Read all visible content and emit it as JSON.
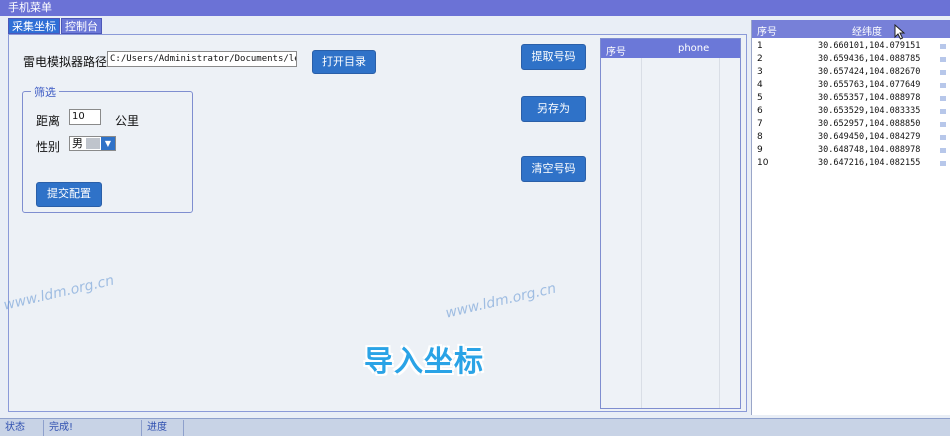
{
  "menubar": {
    "title": "手机菜单"
  },
  "tabs": [
    {
      "label": "采集坐标",
      "active": true
    },
    {
      "label": "控制台",
      "active": false
    }
  ],
  "form": {
    "path_label": "雷电模拟器路径",
    "path_value": "C:/Users/Administrator/Documents/leidi",
    "open_dir_label": "打开目录",
    "filter_group_label": "筛选",
    "distance_label": "距离",
    "distance_value": "10",
    "distance_unit": "公里",
    "gender_label": "性别",
    "gender_value": "男",
    "submit_label": "提交配置"
  },
  "actions": {
    "extract_label": "提取号码",
    "save_as_label": "另存为",
    "clear_label": "清空号码"
  },
  "phone_table": {
    "col_index": "序号",
    "col_phone": "phone"
  },
  "coord_table": {
    "col_index": "序号",
    "col_coord": "经纬度",
    "rows": [
      {
        "n": "1",
        "coord": "30.660101,104.079151"
      },
      {
        "n": "2",
        "coord": "30.659436,104.088785"
      },
      {
        "n": "3",
        "coord": "30.657424,104.082670"
      },
      {
        "n": "4",
        "coord": "30.655763,104.077649"
      },
      {
        "n": "5",
        "coord": "30.655357,104.088978"
      },
      {
        "n": "6",
        "coord": "30.653529,104.083335"
      },
      {
        "n": "7",
        "coord": "30.652957,104.088850"
      },
      {
        "n": "8",
        "coord": "30.649450,104.084279"
      },
      {
        "n": "9",
        "coord": "30.648748,104.088978"
      },
      {
        "n": "10",
        "coord": "30.647216,104.082155"
      }
    ]
  },
  "overlay_caption": "导入坐标",
  "watermark": "www.ldm.org.cn",
  "status": {
    "label": "状态",
    "value": "完成!",
    "progress_label": "进度"
  },
  "colors": {
    "accent": "#2f72c8",
    "header": "#6b78d8",
    "caption": "#2aa3e6"
  }
}
